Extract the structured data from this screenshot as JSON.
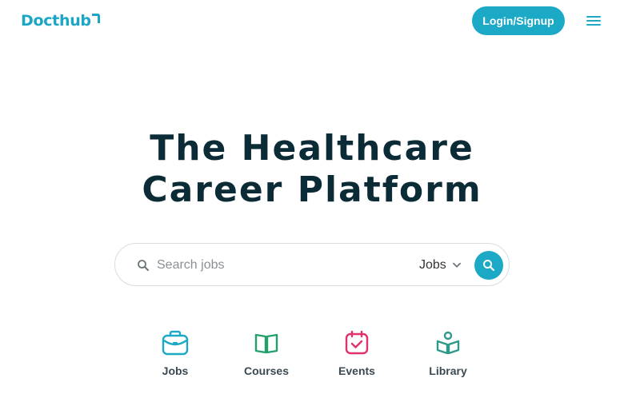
{
  "header": {
    "logo_text": "Docthub",
    "login_label": "Login/Signup",
    "menu_icon": "hamburger-menu-icon"
  },
  "hero": {
    "title_line1": "The Healthcare",
    "title_line2": "Career Platform"
  },
  "search": {
    "placeholder": "Search jobs",
    "value": "",
    "type_selected": "Jobs",
    "search_icon": "search-icon",
    "submit_icon": "search-icon"
  },
  "categories": [
    {
      "label": "Jobs",
      "icon": "briefcase-icon"
    },
    {
      "label": "Courses",
      "icon": "open-book-icon"
    },
    {
      "label": "Events",
      "icon": "calendar-check-icon"
    },
    {
      "label": "Library",
      "icon": "reader-book-icon"
    }
  ],
  "colors": {
    "brand": "#1ba9c6",
    "title": "#0b2b36",
    "events_accent": "#e0336c",
    "library_accent": "#2d9a8a",
    "courses_accent": "#22a06b"
  }
}
